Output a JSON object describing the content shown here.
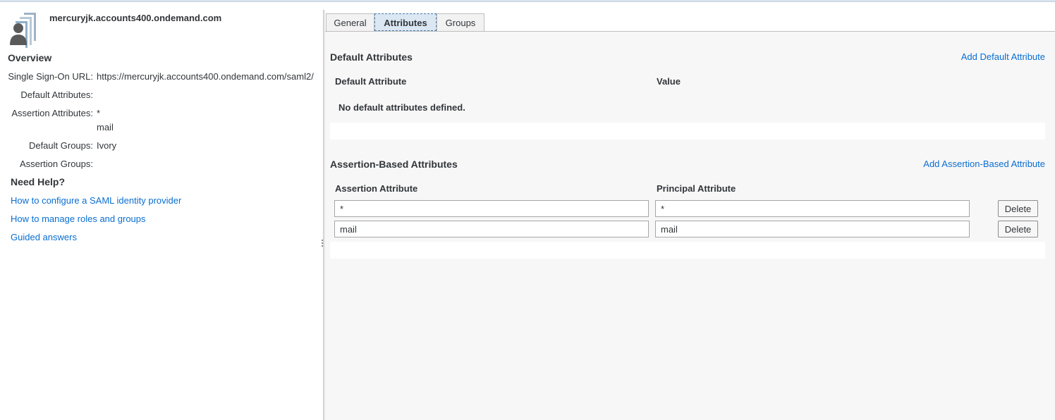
{
  "identity_provider": {
    "host": "mercuryjk.accounts400.ondemand.com",
    "avatar_icon": "user-avatar-icon"
  },
  "overview": {
    "title": "Overview",
    "properties": [
      {
        "label": "Single Sign-On URL:",
        "values": [
          "https://mercuryjk.accounts400.ondemand.com/saml2/"
        ]
      },
      {
        "label": "Default Attributes:",
        "values": []
      },
      {
        "label": "Assertion Attributes:",
        "values": [
          "*",
          "mail"
        ]
      },
      {
        "label": "Default Groups:",
        "values": [
          "Ivory"
        ]
      },
      {
        "label": "Assertion Groups:",
        "values": []
      }
    ]
  },
  "help": {
    "title": "Need Help?",
    "links": [
      "How to configure a SAML identity provider",
      "How to manage roles and groups",
      "Guided answers"
    ]
  },
  "tabs": [
    {
      "label": "General",
      "active": false
    },
    {
      "label": "Attributes",
      "active": true
    },
    {
      "label": "Groups",
      "active": false
    }
  ],
  "default_attributes": {
    "title": "Default Attributes",
    "add_link": "Add Default Attribute",
    "col_attribute": "Default Attribute",
    "col_value": "Value",
    "empty_message": "No default attributes defined."
  },
  "assertion_attributes": {
    "title": "Assertion-Based Attributes",
    "add_link": "Add Assertion-Based Attribute",
    "col_assertion": "Assertion Attribute",
    "col_principal": "Principal Attribute",
    "rows": [
      {
        "assertion": "*",
        "principal": "*",
        "delete_label": "Delete"
      },
      {
        "assertion": "mail",
        "principal": "mail",
        "delete_label": "Delete"
      }
    ]
  },
  "colors": {
    "link": "#0a6ed1",
    "panel_bg": "#f7f7f7",
    "active_tab_bg": "#dbe7f3"
  }
}
